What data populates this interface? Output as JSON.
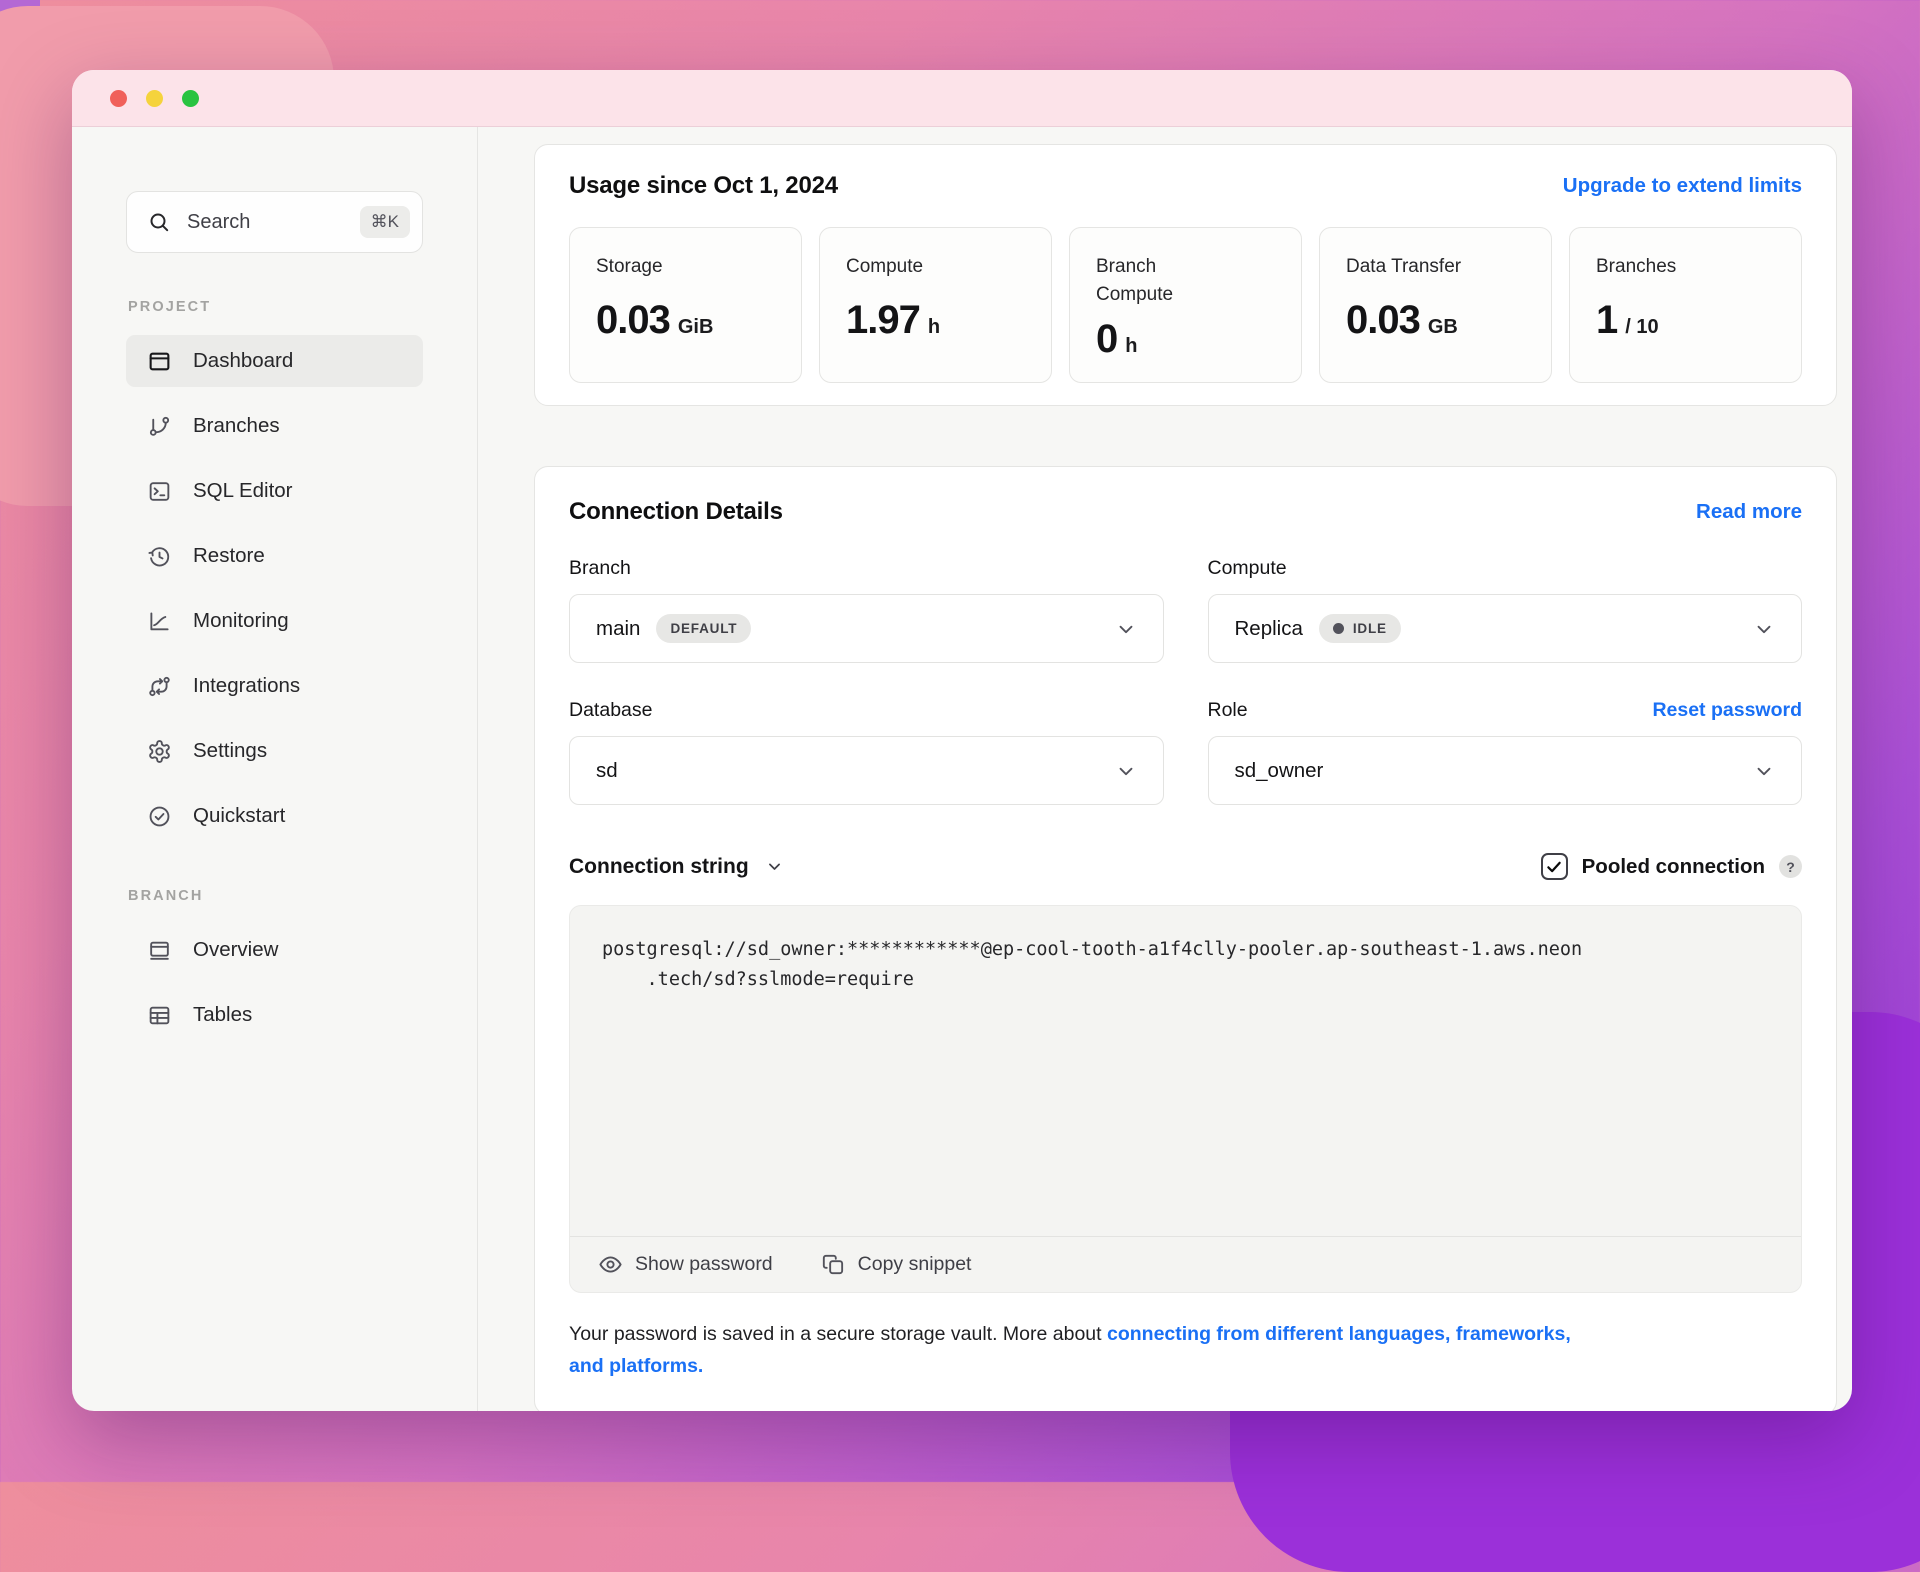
{
  "window": {
    "traffic_lights": [
      "close",
      "minimize",
      "zoom"
    ]
  },
  "sidebar": {
    "search": {
      "label": "Search",
      "shortcut": "⌘K"
    },
    "sections": [
      {
        "label": "PROJECT",
        "items": [
          {
            "label": "Dashboard",
            "icon": "dashboard-icon",
            "active": true
          },
          {
            "label": "Branches",
            "icon": "git-branch-icon",
            "active": false
          },
          {
            "label": "SQL Editor",
            "icon": "terminal-icon",
            "active": false
          },
          {
            "label": "Restore",
            "icon": "history-icon",
            "active": false
          },
          {
            "label": "Monitoring",
            "icon": "chart-line-icon",
            "active": false
          },
          {
            "label": "Integrations",
            "icon": "integrations-icon",
            "active": false
          },
          {
            "label": "Settings",
            "icon": "gear-icon",
            "active": false
          },
          {
            "label": "Quickstart",
            "icon": "check-circle-icon",
            "active": false
          }
        ]
      },
      {
        "label": "BRANCH",
        "items": [
          {
            "label": "Overview",
            "icon": "window-icon",
            "active": false
          },
          {
            "label": "Tables",
            "icon": "table-icon",
            "active": false
          }
        ]
      }
    ]
  },
  "usage": {
    "title": "Usage since Oct 1, 2024",
    "upgrade_link": "Upgrade to extend limits",
    "cards": [
      {
        "label": "Storage",
        "value": "0.03",
        "unit": "GiB"
      },
      {
        "label": "Compute",
        "value": "1.97",
        "unit": "h"
      },
      {
        "label": "Branch Compute",
        "value": "0",
        "unit": "h"
      },
      {
        "label": "Data Transfer",
        "value": "0.03",
        "unit": "GB"
      },
      {
        "label": "Branches",
        "value": "1",
        "unit": "/ 10"
      }
    ]
  },
  "connection": {
    "title": "Connection Details",
    "read_more_link": "Read more",
    "branch": {
      "label": "Branch",
      "value": "main",
      "badge": "DEFAULT"
    },
    "compute": {
      "label": "Compute",
      "value": "Replica",
      "badge": "IDLE"
    },
    "database": {
      "label": "Database",
      "value": "sd"
    },
    "role": {
      "label": "Role",
      "value": "sd_owner",
      "reset_link": "Reset password"
    },
    "string": {
      "label": "Connection string",
      "pooled_label": "Pooled connection",
      "pooled_checked": true,
      "help_badge": "?",
      "code_line1": "postgresql://sd_owner:************@ep-cool-tooth-a1f4clly-pooler.ap-southeast-1.aws.neon",
      "code_line2": ".tech/sd?sslmode=require",
      "show_password": "Show password",
      "copy_snippet": "Copy snippet"
    },
    "note": {
      "text": "Your password is saved in a secure storage vault. More about ",
      "link": "connecting from different languages, frameworks, and platforms."
    }
  },
  "colors": {
    "accent_blue": "#1a70f5",
    "traffic_red": "#f0605a",
    "traffic_yellow": "#f5d33c",
    "traffic_green": "#29c340",
    "badge_bg": "#e7e7e5",
    "code_bg": "#f4f4f2"
  }
}
